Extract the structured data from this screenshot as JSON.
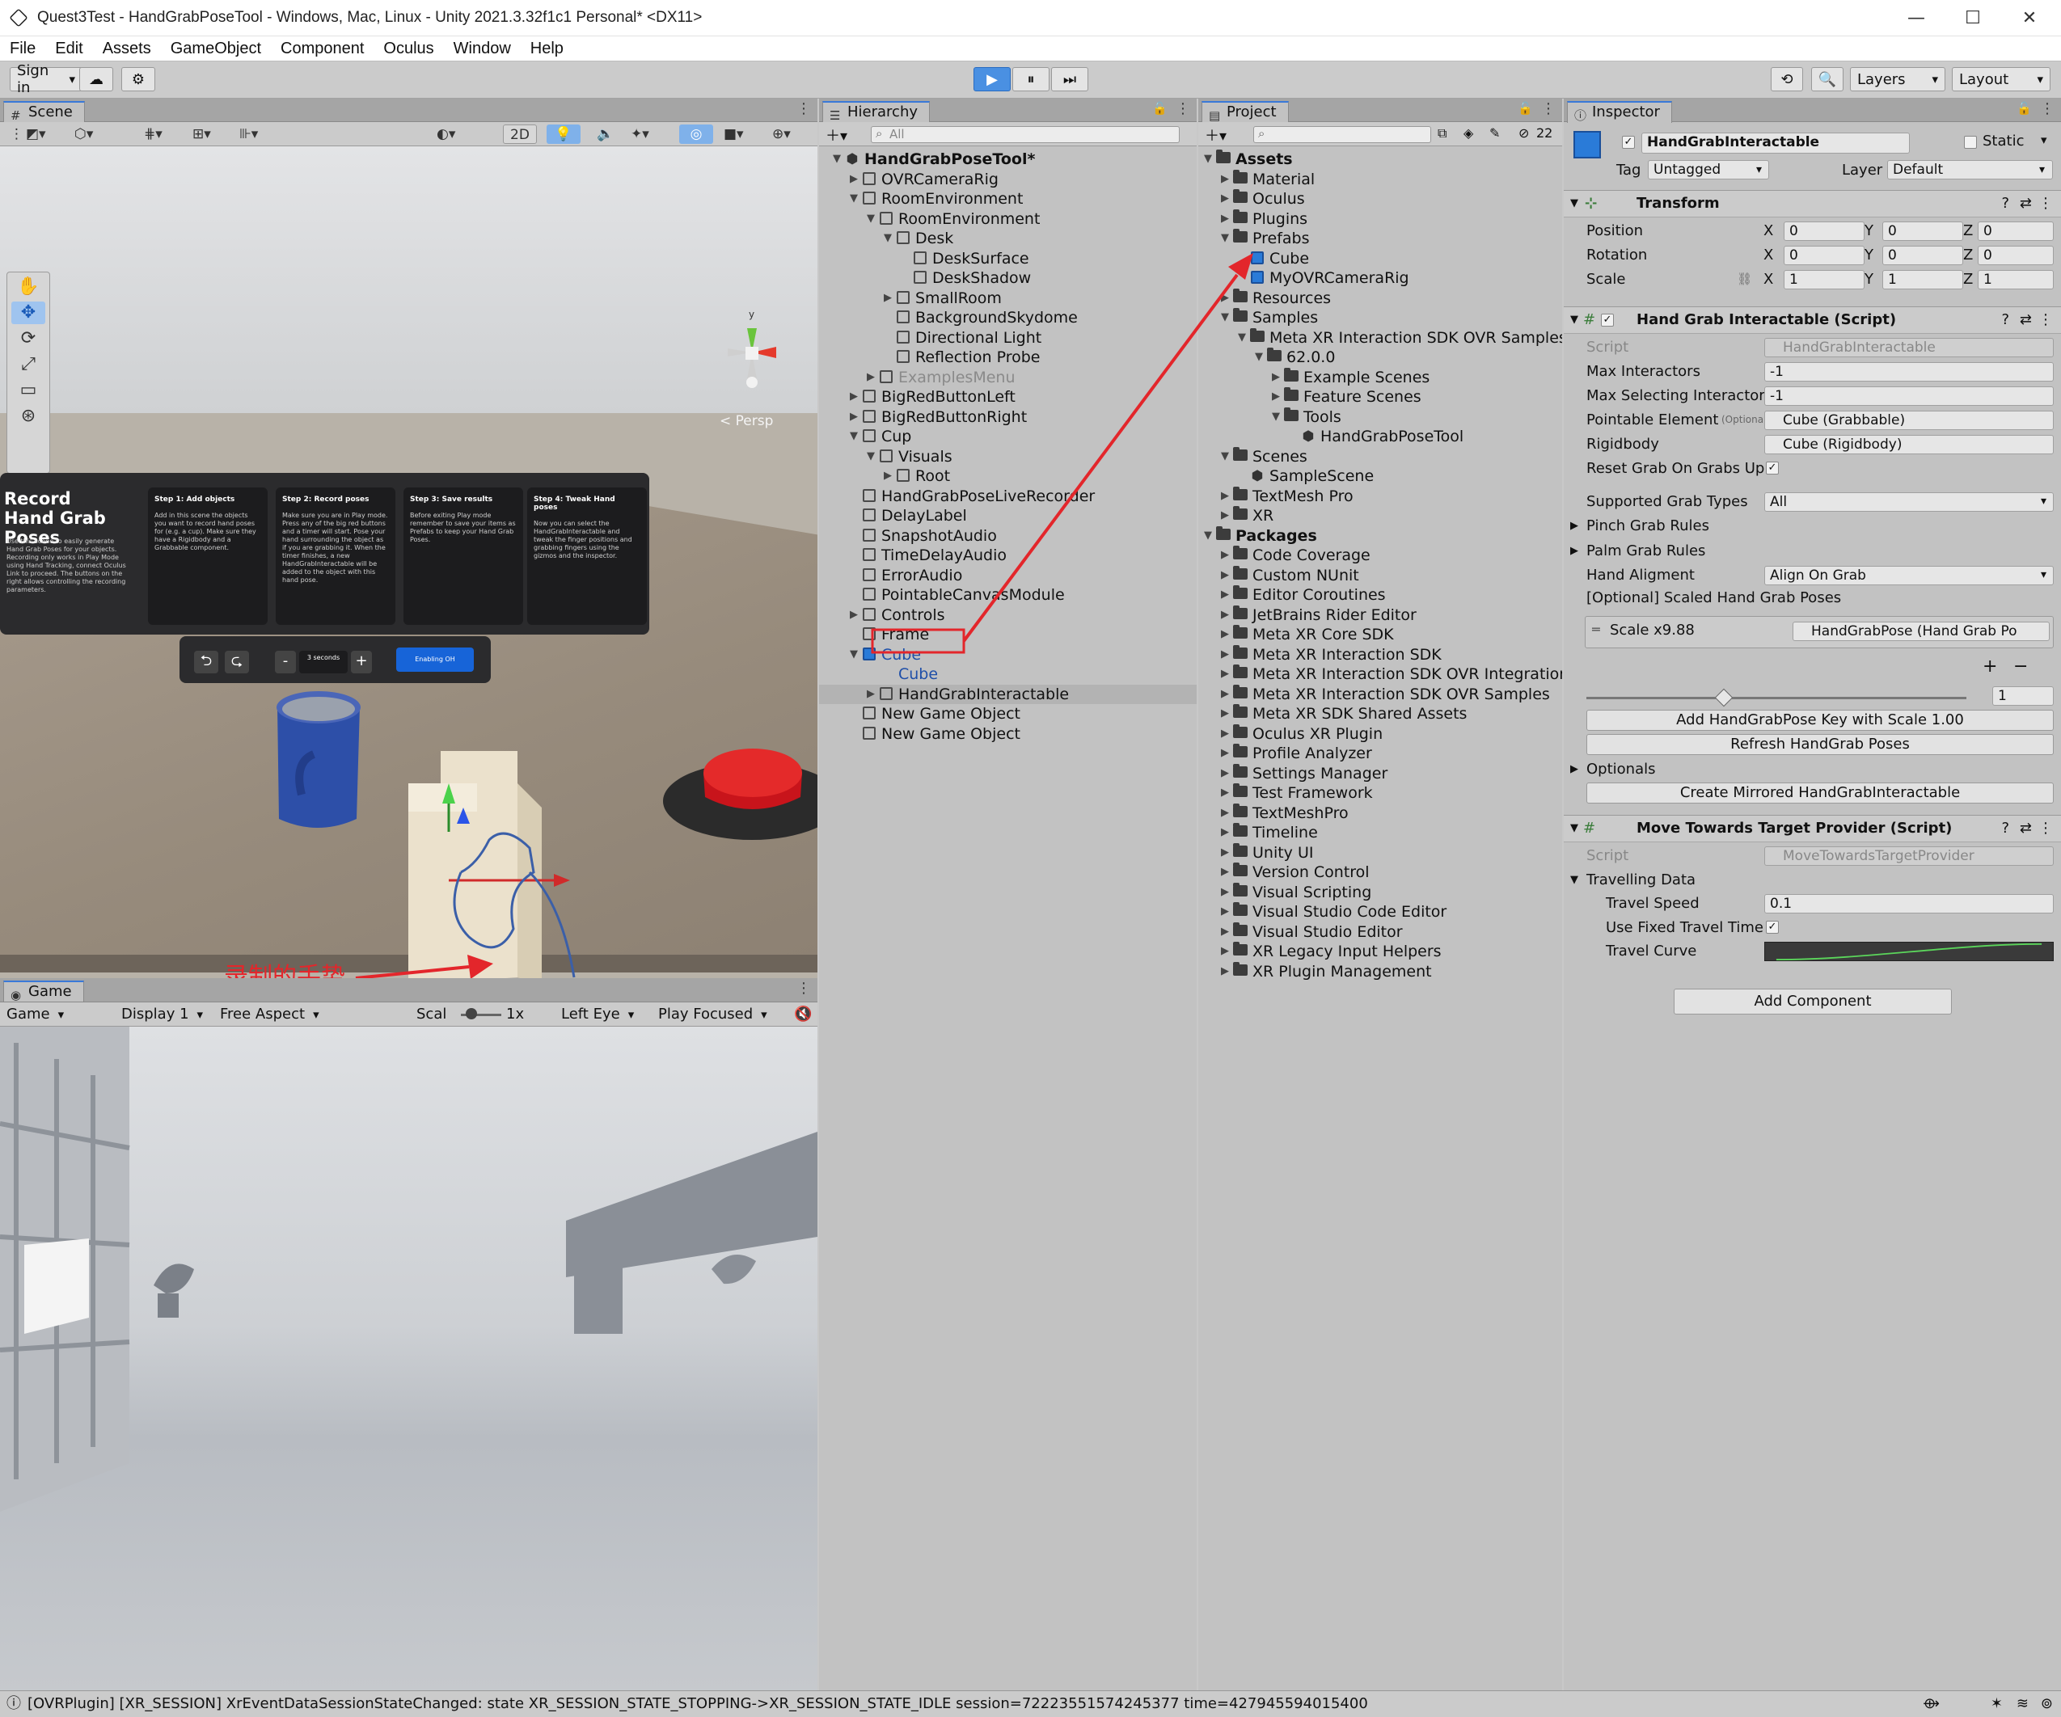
{
  "window": {
    "title": "Quest3Test - HandGrabPoseTool - Windows, Mac, Linux - Unity 2021.3.32f1c1 Personal* <DX11>",
    "minimize": "—",
    "maximize": "☐",
    "close": "✕"
  },
  "menu": [
    "File",
    "Edit",
    "Assets",
    "GameObject",
    "Component",
    "Oculus",
    "Window",
    "Help"
  ],
  "toolbar": {
    "sign_in": "Sign in",
    "cloud": "☁",
    "settings": "⚙",
    "play": "▶",
    "pause": "⏸",
    "step": "⏭",
    "history": "⟲",
    "search": "🔍",
    "layers": "Layers",
    "layout": "Layout"
  },
  "scene": {
    "tab": "Scene",
    "btn_2d": "2D",
    "persp": "< Persp",
    "gizmo_y": "y",
    "record_title": "Record Hand Grab Poses",
    "record_body": "Use this scene to easily generate Hand Grab Poses for your objects. Recording only works in Play Mode using Hand Tracking, connect Oculus Link to proceed. The buttons on the right allows controlling the recording parameters.",
    "steps": [
      {
        "title": "Step 1: Add objects",
        "text": "Add in this scene the objects you want to record hand poses for (e.g. a cup). Make sure they have a Rigidbody and a Grabbable component."
      },
      {
        "title": "Step 2: Record poses",
        "text": "Make sure you are in Play mode. Press any of the big red buttons and a timer will start. Pose your hand surrounding the object as if you are grabbing it. When the timer finishes, a new HandGrabInteractable will be added to the object with this hand pose."
      },
      {
        "title": "Step 3: Save results",
        "text": "Before exiting Play mode remember to save your items as Prefabs to keep your Hand Grab Poses."
      },
      {
        "title": "Step 4: Tweak Hand poses",
        "text": "Now you can select the HandGrabInteractable and tweak the finger positions and grabbing fingers using the gizmos and the inspector."
      }
    ],
    "controls": {
      "undo": "⮌",
      "redo": "⮎",
      "minus": "-",
      "seconds": "3 seconds",
      "plus": "+",
      "enable": "Enabling OH"
    },
    "annotation": "录制的手势"
  },
  "game": {
    "tab": "Game",
    "mode": "Game",
    "display": "Display 1",
    "aspect": "Free Aspect",
    "scale_label": "Scal",
    "scale_value": "1x",
    "eye": "Left Eye",
    "play_focused": "Play Focused",
    "mute": "🔇"
  },
  "hierarchy": {
    "tab": "Hierarchy",
    "search_placeholder": "All",
    "rows": [
      {
        "label": "HandGrabPoseTool*",
        "indent": 0,
        "arrow": "▼",
        "icon": "unity",
        "bold": true
      },
      {
        "label": "OVRCameraRig",
        "indent": 1,
        "arrow": "▶",
        "icon": "cube"
      },
      {
        "label": "RoomEnvironment",
        "indent": 1,
        "arrow": "▼",
        "icon": "cube"
      },
      {
        "label": "RoomEnvironment",
        "indent": 2,
        "arrow": "▼",
        "icon": "cube"
      },
      {
        "label": "Desk",
        "indent": 3,
        "arrow": "▼",
        "icon": "cube"
      },
      {
        "label": "DeskSurface",
        "indent": 4,
        "arrow": "",
        "icon": "cube"
      },
      {
        "label": "DeskShadow",
        "indent": 4,
        "arrow": "",
        "icon": "cube"
      },
      {
        "label": "SmallRoom",
        "indent": 3,
        "arrow": "▶",
        "icon": "cube"
      },
      {
        "label": "BackgroundSkydome",
        "indent": 3,
        "arrow": "",
        "icon": "cube"
      },
      {
        "label": "Directional Light",
        "indent": 3,
        "arrow": "",
        "icon": "cube"
      },
      {
        "label": "Reflection Probe",
        "indent": 3,
        "arrow": "",
        "icon": "cube"
      },
      {
        "label": "ExamplesMenu",
        "indent": 2,
        "arrow": "▶",
        "icon": "cube",
        "dim": true
      },
      {
        "label": "BigRedButtonLeft",
        "indent": 1,
        "arrow": "▶",
        "icon": "cube"
      },
      {
        "label": "BigRedButtonRight",
        "indent": 1,
        "arrow": "▶",
        "icon": "cube"
      },
      {
        "label": "Cup",
        "indent": 1,
        "arrow": "▼",
        "icon": "cube"
      },
      {
        "label": "Visuals",
        "indent": 2,
        "arrow": "▼",
        "icon": "cube"
      },
      {
        "label": "Root",
        "indent": 3,
        "arrow": "▶",
        "icon": "cube"
      },
      {
        "label": "HandGrabPoseLiveRecorder",
        "indent": 1,
        "arrow": "",
        "icon": "cube"
      },
      {
        "label": "DelayLabel",
        "indent": 1,
        "arrow": "",
        "icon": "cube"
      },
      {
        "label": "SnapshotAudio",
        "indent": 1,
        "arrow": "",
        "icon": "cube"
      },
      {
        "label": "TimeDelayAudio",
        "indent": 1,
        "arrow": "",
        "icon": "cube"
      },
      {
        "label": "ErrorAudio",
        "indent": 1,
        "arrow": "",
        "icon": "cube"
      },
      {
        "label": "PointableCanvasModule",
        "indent": 1,
        "arrow": "",
        "icon": "cube"
      },
      {
        "label": "Controls",
        "indent": 1,
        "arrow": "▶",
        "icon": "cube"
      },
      {
        "label": "Frame",
        "indent": 1,
        "arrow": "",
        "icon": "cube"
      },
      {
        "label": "Cube",
        "indent": 1,
        "arrow": "▼",
        "icon": "bluecube",
        "blue": true,
        "boxed": true
      },
      {
        "label": "Cube",
        "indent": 2,
        "arrow": "",
        "icon": "none",
        "blue": true
      },
      {
        "label": "HandGrabInteractable",
        "indent": 2,
        "arrow": "▶",
        "icon": "cube",
        "selected": true
      },
      {
        "label": "New Game Object",
        "indent": 1,
        "arrow": "",
        "icon": "cube"
      },
      {
        "label": "New Game Object",
        "indent": 1,
        "arrow": "",
        "icon": "cube"
      }
    ]
  },
  "project": {
    "tab": "Project",
    "hidden_count": "22",
    "rows": [
      {
        "label": "Assets",
        "indent": 0,
        "arrow": "▼",
        "icon": "folder",
        "bold": true
      },
      {
        "label": "Material",
        "indent": 1,
        "arrow": "▶",
        "icon": "folder"
      },
      {
        "label": "Oculus",
        "indent": 1,
        "arrow": "▶",
        "icon": "folder"
      },
      {
        "label": "Plugins",
        "indent": 1,
        "arrow": "▶",
        "icon": "folder"
      },
      {
        "label": "Prefabs",
        "indent": 1,
        "arrow": "▼",
        "icon": "folder"
      },
      {
        "label": "Cube",
        "indent": 2,
        "arrow": "",
        "icon": "bluecube"
      },
      {
        "label": "MyOVRCameraRig",
        "indent": 2,
        "arrow": "",
        "icon": "bluecube"
      },
      {
        "label": "Resources",
        "indent": 1,
        "arrow": "▶",
        "icon": "folder"
      },
      {
        "label": "Samples",
        "indent": 1,
        "arrow": "▼",
        "icon": "folder"
      },
      {
        "label": "Meta XR Interaction SDK OVR Samples",
        "indent": 2,
        "arrow": "▼",
        "icon": "folder"
      },
      {
        "label": "62.0.0",
        "indent": 3,
        "arrow": "▼",
        "icon": "folder"
      },
      {
        "label": "Example Scenes",
        "indent": 4,
        "arrow": "▶",
        "icon": "folder"
      },
      {
        "label": "Feature Scenes",
        "indent": 4,
        "arrow": "▶",
        "icon": "folder"
      },
      {
        "label": "Tools",
        "indent": 4,
        "arrow": "▼",
        "icon": "folder"
      },
      {
        "label": "HandGrabPoseTool",
        "indent": 5,
        "arrow": "",
        "icon": "unity"
      },
      {
        "label": "Scenes",
        "indent": 1,
        "arrow": "▼",
        "icon": "folder"
      },
      {
        "label": "SampleScene",
        "indent": 2,
        "arrow": "",
        "icon": "unity"
      },
      {
        "label": "TextMesh Pro",
        "indent": 1,
        "arrow": "▶",
        "icon": "folder"
      },
      {
        "label": "XR",
        "indent": 1,
        "arrow": "▶",
        "icon": "folder"
      },
      {
        "label": "Packages",
        "indent": 0,
        "arrow": "▼",
        "icon": "folder",
        "bold": true
      },
      {
        "label": "Code Coverage",
        "indent": 1,
        "arrow": "▶",
        "icon": "folder"
      },
      {
        "label": "Custom NUnit",
        "indent": 1,
        "arrow": "▶",
        "icon": "folder"
      },
      {
        "label": "Editor Coroutines",
        "indent": 1,
        "arrow": "▶",
        "icon": "folder"
      },
      {
        "label": "JetBrains Rider Editor",
        "indent": 1,
        "arrow": "▶",
        "icon": "folder"
      },
      {
        "label": "Meta XR Core SDK",
        "indent": 1,
        "arrow": "▶",
        "icon": "folder"
      },
      {
        "label": "Meta XR Interaction SDK",
        "indent": 1,
        "arrow": "▶",
        "icon": "folder"
      },
      {
        "label": "Meta XR Interaction SDK OVR Integration",
        "indent": 1,
        "arrow": "▶",
        "icon": "folder"
      },
      {
        "label": "Meta XR Interaction SDK OVR Samples",
        "indent": 1,
        "arrow": "▶",
        "icon": "folder"
      },
      {
        "label": "Meta XR SDK Shared Assets",
        "indent": 1,
        "arrow": "▶",
        "icon": "folder"
      },
      {
        "label": "Oculus XR Plugin",
        "indent": 1,
        "arrow": "▶",
        "icon": "folder"
      },
      {
        "label": "Profile Analyzer",
        "indent": 1,
        "arrow": "▶",
        "icon": "folder"
      },
      {
        "label": "Settings Manager",
        "indent": 1,
        "arrow": "▶",
        "icon": "folder"
      },
      {
        "label": "Test Framework",
        "indent": 1,
        "arrow": "▶",
        "icon": "folder"
      },
      {
        "label": "TextMeshPro",
        "indent": 1,
        "arrow": "▶",
        "icon": "folder"
      },
      {
        "label": "Timeline",
        "indent": 1,
        "arrow": "▶",
        "icon": "folder"
      },
      {
        "label": "Unity UI",
        "indent": 1,
        "arrow": "▶",
        "icon": "folder"
      },
      {
        "label": "Version Control",
        "indent": 1,
        "arrow": "▶",
        "icon": "folder"
      },
      {
        "label": "Visual Scripting",
        "indent": 1,
        "arrow": "▶",
        "icon": "folder"
      },
      {
        "label": "Visual Studio Code Editor",
        "indent": 1,
        "arrow": "▶",
        "icon": "folder"
      },
      {
        "label": "Visual Studio Editor",
        "indent": 1,
        "arrow": "▶",
        "icon": "folder"
      },
      {
        "label": "XR Legacy Input Helpers",
        "indent": 1,
        "arrow": "▶",
        "icon": "folder"
      },
      {
        "label": "XR Plugin Management",
        "indent": 1,
        "arrow": "▶",
        "icon": "folder"
      }
    ]
  },
  "inspector": {
    "tab": "Inspector",
    "object_name": "HandGrabInteractable",
    "static_label": "Static",
    "tag_label": "Tag",
    "tag_value": "Untagged",
    "layer_label": "Layer",
    "layer_value": "Default",
    "transform": {
      "title": "Transform",
      "position": {
        "label": "Position",
        "x": "0",
        "y": "0",
        "z": "0"
      },
      "rotation": {
        "label": "Rotation",
        "x": "0",
        "y": "0",
        "z": "0"
      },
      "scale": {
        "label": "Scale",
        "x": "1",
        "y": "1",
        "z": "1"
      }
    },
    "hgi": {
      "title": "Hand Grab Interactable (Script)",
      "script_label": "Script",
      "script_value": "HandGrabInteractable",
      "max_interactors_label": "Max Interactors",
      "max_interactors": "-1",
      "max_selecting_label": "Max Selecting Interactor",
      "max_selecting": "-1",
      "pointable_label": "Pointable Element",
      "optional_tag": "(Optional)",
      "pointable_value": "Cube (Grabbable)",
      "rigidbody_label": "Rigidbody",
      "rigidbody_value": "Cube (Rigidbody)",
      "reset_grab_label": "Reset Grab On Grabs Up",
      "supported_label": "Supported Grab Types",
      "supported_value": "All",
      "pinch_label": "Pinch Grab Rules",
      "palm_label": "Palm Grab Rules",
      "alignment_label": "Hand Aligment",
      "alignment_value": "Align On Grab",
      "scaled_label": "[Optional] Scaled Hand Grab Poses",
      "scale_item_label": "Scale x9.88",
      "scale_item_value": "HandGrabPose (Hand Grab Po",
      "add_btn": "+",
      "remove_btn": "−",
      "slider_value": "1",
      "add_key_btn": "Add HandGrabPose Key with Scale 1.00",
      "refresh_btn": "Refresh HandGrab Poses",
      "optionals_label": "Optionals",
      "mirror_btn": "Create Mirrored HandGrabInteractable"
    },
    "mttp": {
      "title": "Move Towards Target Provider (Script)",
      "script_label": "Script",
      "script_value": "MoveTowardsTargetProvider",
      "travelling_label": "Travelling Data",
      "speed_label": "Travel Speed",
      "speed_value": "0.1",
      "fixed_label": "Use Fixed Travel Time",
      "curve_label": "Travel Curve"
    },
    "add_component": "Add Component"
  },
  "status": {
    "message": "[OVRPlugin] [XR_SESSION] XrEventDataSessionStateChanged: state XR_SESSION_STATE_STOPPING->XR_SESSION_STATE_IDLE session=72223551574245377 time=427945594015400"
  },
  "colors": {
    "accent": "#3a79d8",
    "annotation_red": "#e3262b",
    "selection_blue": "#2a7bd8"
  }
}
